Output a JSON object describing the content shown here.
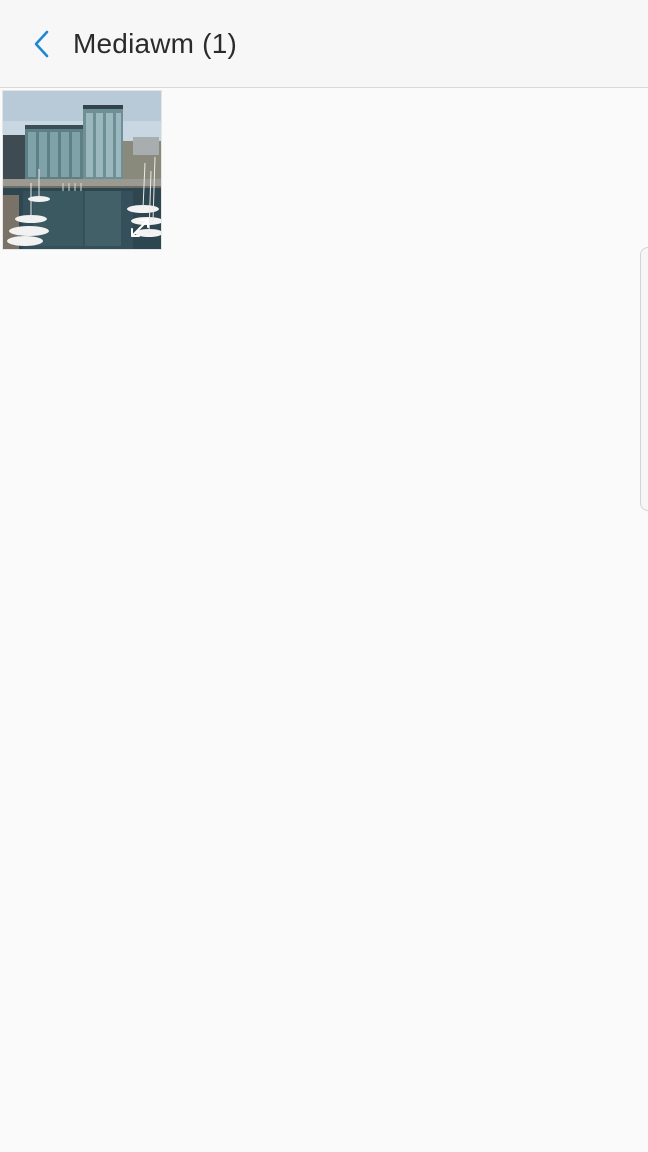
{
  "header": {
    "back_icon": "chevron-left-icon",
    "title": "Mediawm (1)"
  },
  "media": {
    "items": [
      {
        "type": "photo",
        "overlay_icon": "expand-icon"
      }
    ]
  },
  "edge_panel": {
    "icon": "edge-panel-handle"
  },
  "colors": {
    "accent": "#1e88d6",
    "background": "#fafafa",
    "header_bg": "#f7f7f7",
    "title_text": "#2b2b2b"
  }
}
